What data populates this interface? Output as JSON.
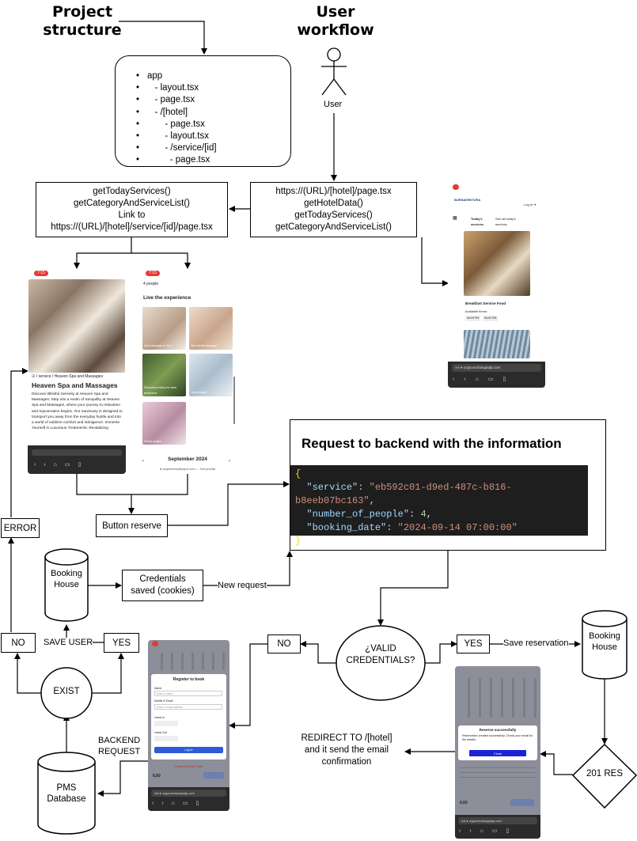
{
  "headers": {
    "project_structure": "Project\nstructure",
    "user_workflow": "User\nworkflow"
  },
  "user_label": "User",
  "structure_items": [
    "app",
    "   - layout.tsx",
    "   - page.tsx",
    "   - /[hotel]",
    "       - page.tsx",
    "       - layout.tsx",
    "       - /service/[id]",
    "         - page.tsx"
  ],
  "left_box_lines": [
    "getTodayServices()",
    "getCategoryAndServiceList()",
    "Link to",
    "https://(URL)/[hotel]/service/[id]/page.tsx"
  ],
  "right_box_lines": [
    "https://(URL)/[hotel]/page.tsx",
    "getHotelData()",
    "getTodayServices()",
    "getCategoryAndServiceList()"
  ],
  "phone_service": {
    "time": "7:15",
    "breadcrumb": "☑ / service / Heaven Spa and Massages",
    "heading": "Heaven Spa and Massages",
    "body": "Discover Blissful Serenity at Heaven Spa and Massages: Step into a realm of tranquility at Heaven Spa and Massages, where your journey to relaxation and rejuvenation begins. Our sanctuary is designed to transport you away from the everyday hustle and into a world of sublime comfort and indulgence. Immerse Yourself in Luxurious Treatments: Revitalizing"
  },
  "phone_experience": {
    "time": "7:15",
    "top_text": "4 people",
    "heading": "Live the experience",
    "tiles": [
      "Spa massage in bed",
      "Spa facial massage",
      "Recovery trolley for best treatment",
      "Hydra facial",
      "Facial masks"
    ],
    "month": "September 2024",
    "url": "● ampimensuttipspa.com — Not private"
  },
  "phone_hotel": {
    "brand": "BUENAVENTURA",
    "login": "Log In ➜",
    "today_label": "Today's services",
    "see_all": "See all today's services",
    "card_title": "Breakfast Service Food",
    "available": "Available times:",
    "times": [
      "06:00 PM",
      "06:00 PM"
    ],
    "url": "AA  ● crypcoechangeplp.com"
  },
  "request_title": "Request to backend with the information",
  "request_json": {
    "service_key": "\"service\"",
    "service_val": "\"eb592c01-d9ed-487c-b816-b8eeb07bc163\"",
    "people_key": "\"number_of_people\"",
    "people_val": "4",
    "date_key": "\"booking_date\"",
    "date_val": "\"2024-09-14 07:00:00\""
  },
  "button_reserve": "Button reserve",
  "error": "ERROR",
  "booking_house_left": "Booking\nHouse",
  "credentials_saved": "Credentials\nsaved (cookies)",
  "new_request": "New request",
  "valid_credentials": "¿VALID\nCREDENTIALS?",
  "no_center": "NO",
  "yes_center": "YES",
  "save_reservation": "Save reservation",
  "booking_house_right": "Booking\nHouse",
  "no_left": "NO",
  "save_user": "SAVE USER",
  "yes_left": "YES",
  "exist": "EXIST",
  "backend_request": "BACKEND\nREQUEST",
  "pms_database": "PMS\nDatabase",
  "phone_register": {
    "heading": "Register to book",
    "fields": [
      "Name",
      "Enter a name",
      "Mobile & Email",
      "Enter a email address",
      "check-in",
      "check-Out"
    ],
    "button": "Log In",
    "footer": "Please Dont Be Rude",
    "price": "6,60",
    "url": "AA  ● crypcoechangeplp.com"
  },
  "phone_confirm": {
    "modal_title": "Reserve successfully",
    "modal_text": "Reservation created successfully. Check your email for the details.",
    "close": "Close",
    "price": "6,60",
    "url": "AA  ● crypcoechangeplp.com"
  },
  "redirect": "REDIRECT TO /[hotel]\nand it send the email\nconfirmation",
  "res_201": "201 RES"
}
